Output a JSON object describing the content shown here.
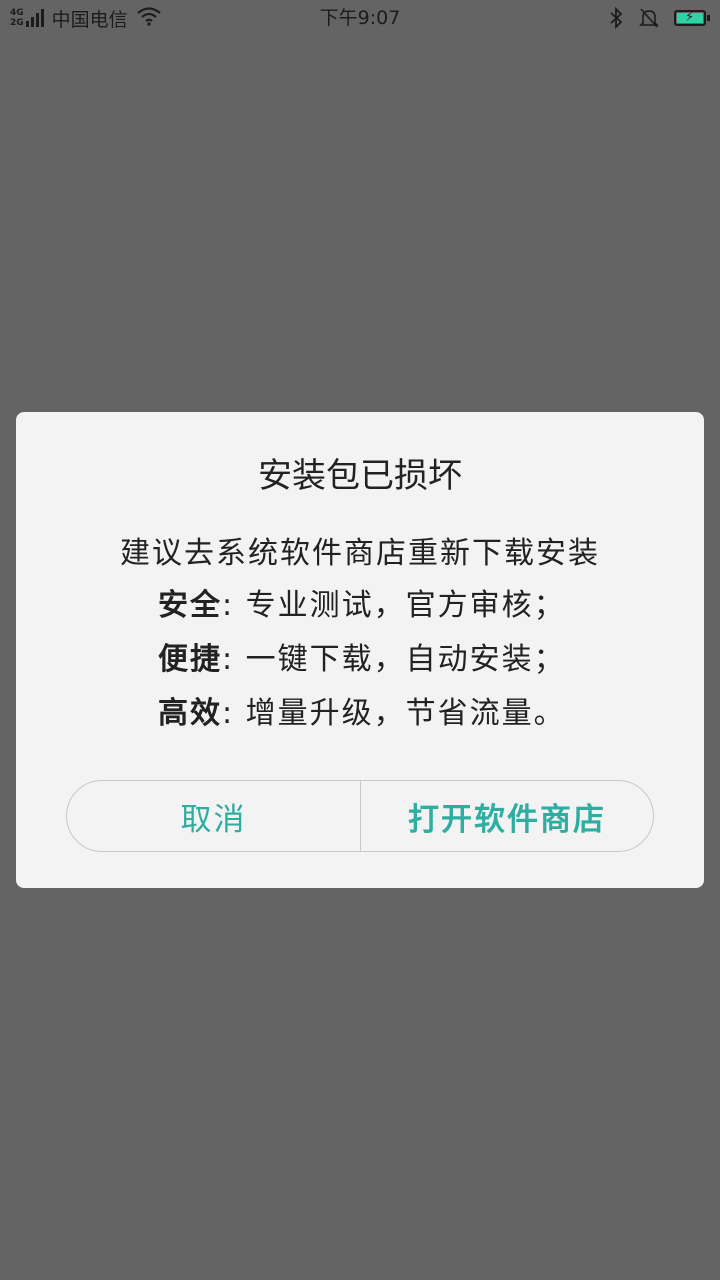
{
  "status_bar": {
    "network_top": "4G",
    "network_bottom": "2G",
    "carrier": "中国电信",
    "time": "下午9:07",
    "bluetooth_icon": "bluetooth-icon",
    "mute_icon": "bell-off-icon",
    "battery_state": "charging"
  },
  "dialog": {
    "title": "安装包已损坏",
    "message": "建议去系统软件商店重新下载安装",
    "features": [
      {
        "key": "安全",
        "sep": ":",
        "value": "专业测试，官方审核；"
      },
      {
        "key": "便捷",
        "sep": ":",
        "value": "一键下载，自动安装；"
      },
      {
        "key": "高效",
        "sep": ":",
        "value": "增量升级，节省流量。"
      }
    ],
    "cancel_label": "取消",
    "open_store_label": "打开软件商店"
  },
  "colors": {
    "overlay": "#646464",
    "dialog_bg": "#f3f3f3",
    "accent": "#2eaea0",
    "battery": "#2fd1a6"
  }
}
